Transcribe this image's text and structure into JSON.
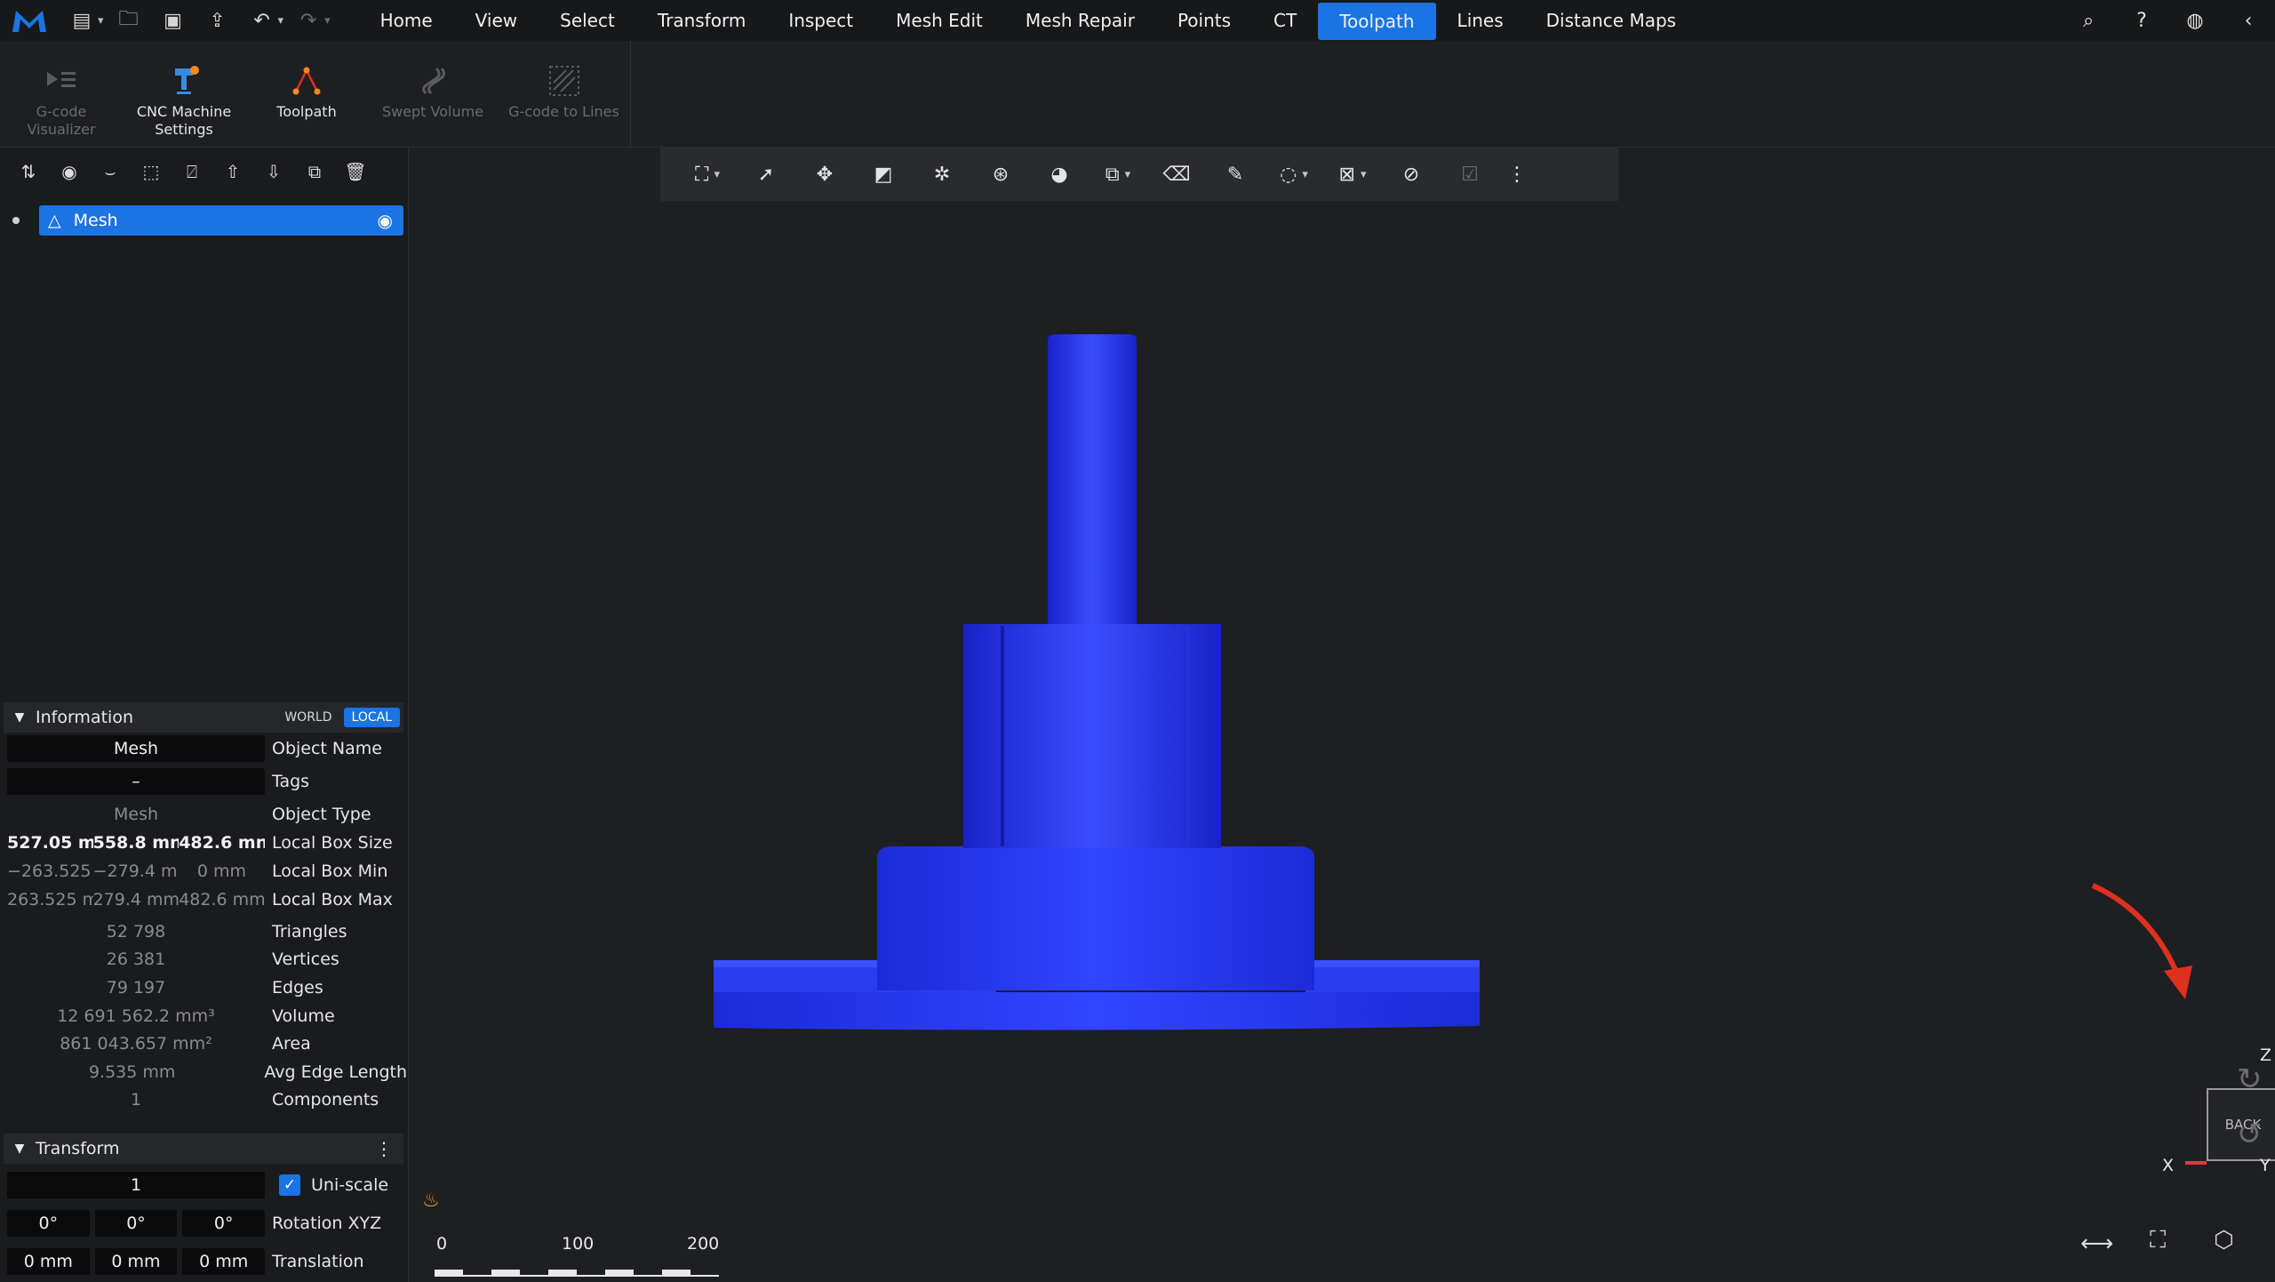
{
  "colors": {
    "accent": "#1b74e4",
    "mesh": "#2336f0",
    "annotation_arrow": "#e0301e",
    "x_axis": "#e03a3a",
    "y_axis": "#3a9ae0",
    "z_axis": "#3a8ae0"
  },
  "quick_access": {
    "icons": [
      "new-doc-icon",
      "open-folder-icon",
      "save-icon",
      "export-icon",
      "undo-icon",
      "redo-icon"
    ]
  },
  "menu": {
    "items": [
      "Home",
      "View",
      "Select",
      "Transform",
      "Inspect",
      "Mesh Edit",
      "Mesh Repair",
      "Points",
      "CT",
      "Toolpath",
      "Lines",
      "Distance Maps"
    ],
    "active": "Toolpath"
  },
  "ribbon": {
    "gcode_visualizer": "G-code Visualizer",
    "cnc_settings": "CNC Machine Settings",
    "toolpath": "Toolpath",
    "swept_volume": "Swept Volume",
    "gcode_to_lines": "G-code to Lines"
  },
  "tree": {
    "item": "Mesh"
  },
  "information": {
    "title": "Information",
    "world": "WORLD",
    "local": "LOCAL",
    "object_name_label": "Object Name",
    "object_name": "Mesh",
    "tags_label": "Tags",
    "tags": "–",
    "object_type_label": "Object Type",
    "object_type": "Mesh",
    "box_size_label": "Local Box Size",
    "box_size": [
      "527.05 mı",
      "558.8 mn",
      "482.6 mn"
    ],
    "box_min_label": "Local Box Min",
    "box_min": [
      "−263.525 ı",
      "−279.4 mr",
      "0 mm"
    ],
    "box_max_label": "Local Box Max",
    "box_max": [
      "263.525 m",
      "279.4 mm",
      "482.6 mm"
    ],
    "triangles_label": "Triangles",
    "triangles": "52 798",
    "vertices_label": "Vertices",
    "vertices": "26 381",
    "edges_label": "Edges",
    "edges": "79 197",
    "volume_label": "Volume",
    "volume": "12 691 562.2 mm³",
    "area_label": "Area",
    "area": "861 043.657 mm²",
    "avg_edge_label": "Avg Edge Length",
    "avg_edge": "9.535 mm",
    "components_label": "Components",
    "components": "1"
  },
  "transform": {
    "title": "Transform",
    "scale": "1",
    "uniscale_label": "Uni-scale",
    "rotation": [
      "0°",
      "0°",
      "0°"
    ],
    "rotation_label": "Rotation XYZ",
    "translation": [
      "0 mm",
      "0 mm",
      "0 mm"
    ],
    "translation_label": "Translation"
  },
  "scale_bar": {
    "ticks": [
      "0",
      "100",
      "200"
    ]
  },
  "view_cube": {
    "face": "BACK",
    "x": "X",
    "y": "Y",
    "z": "Z"
  }
}
